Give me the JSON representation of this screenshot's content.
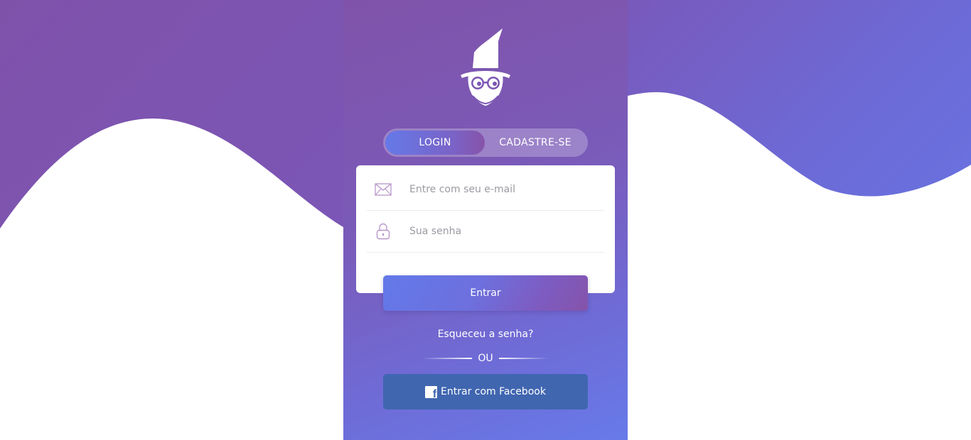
{
  "toggle": {
    "login_label": "LOGIN",
    "signup_label": "CADASTRE-SE"
  },
  "form": {
    "email_placeholder": "Entre com seu e-mail",
    "password_placeholder": "Sua senha",
    "submit_label": "Entrar"
  },
  "links": {
    "forgot_password": "Esqueceu a senha?",
    "divider_text": "OU"
  },
  "social": {
    "facebook_label": "Entrar com Facebook"
  },
  "icons": {
    "logo": "wizard-logo-icon",
    "email": "envelope-icon",
    "password": "lock-icon",
    "facebook": "facebook-icon"
  },
  "colors": {
    "gradient_start": "#7f52aa",
    "gradient_end": "#6579e8",
    "facebook": "#4066b0",
    "card": "#ffffff",
    "icon_stroke": "#b796c9"
  }
}
